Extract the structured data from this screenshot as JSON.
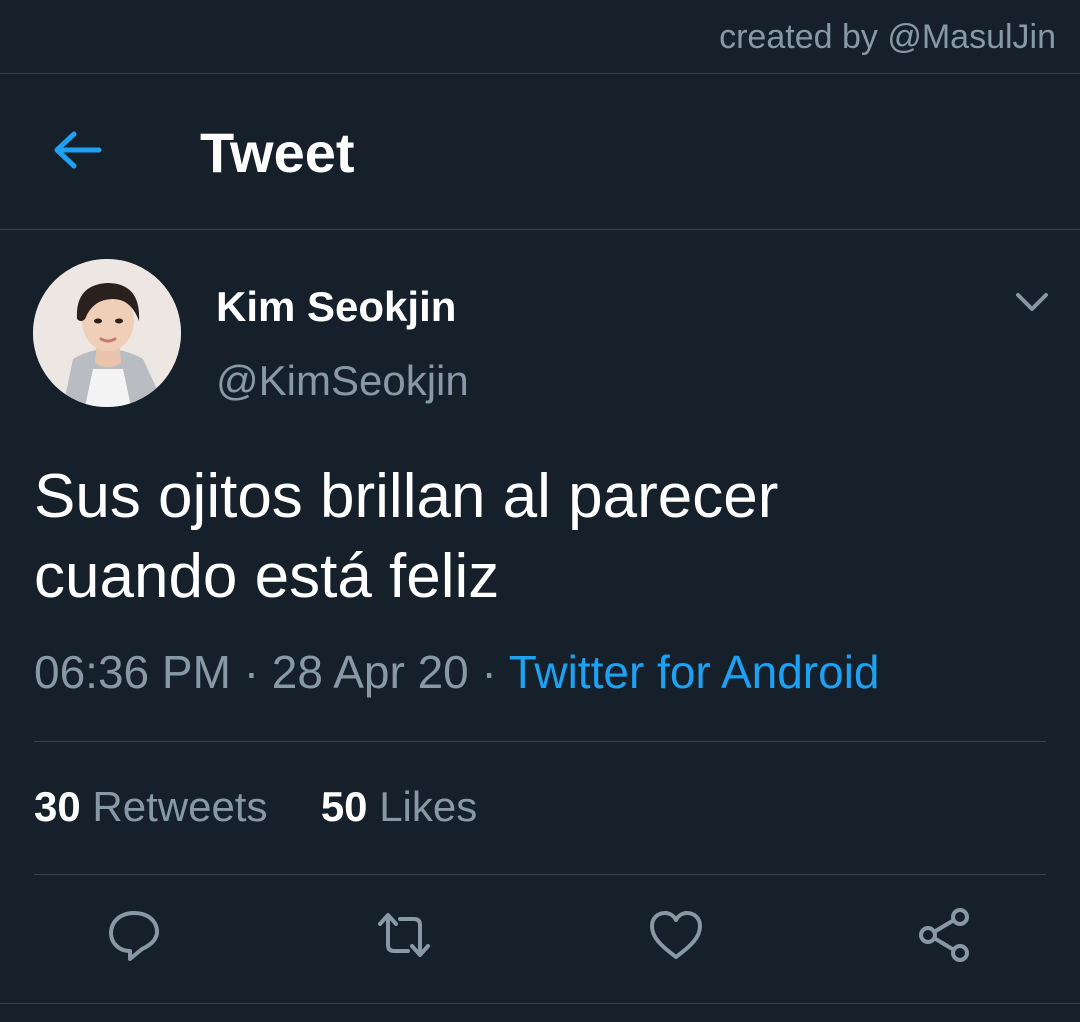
{
  "watermark": {
    "text": "created by @MasulJin"
  },
  "header": {
    "title": "Tweet",
    "back_icon": "arrow-left-icon"
  },
  "tweet": {
    "display_name": "Kim Seokjin",
    "handle": "@KimSeokjin",
    "text_line1": "Sus ojitos brillan al parecer",
    "text_line2": "cuando está feliz",
    "time": "06:36 PM",
    "date": "28 Apr 20",
    "separator": "·",
    "source": "Twitter for Android",
    "retweets_count": "30",
    "retweets_label": "Retweets",
    "likes_count": "50",
    "likes_label": "Likes"
  },
  "icons": {
    "caret": "chevron-down-icon",
    "reply": "reply-icon",
    "retweet": "retweet-icon",
    "like": "heart-icon",
    "share": "share-icon"
  },
  "colors": {
    "background": "#15202b",
    "accent": "#1da1f2",
    "secondary_text": "#8899a6",
    "divider": "#38444d"
  }
}
